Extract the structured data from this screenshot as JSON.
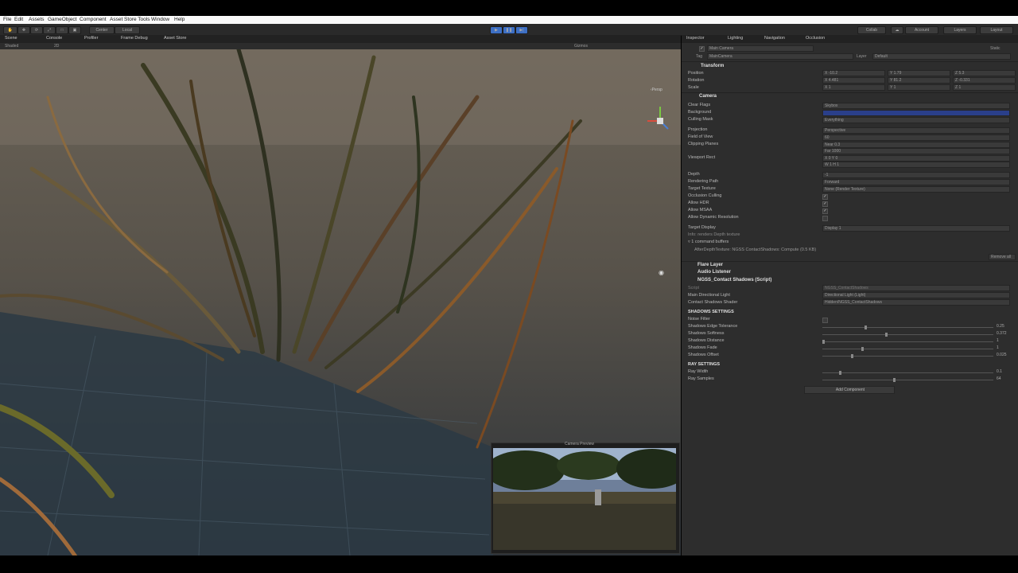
{
  "menu": [
    "File",
    "Edit",
    "Assets",
    "GameObject",
    "Component",
    "Asset Store Tools",
    "Window",
    "Help"
  ],
  "toolbar": {
    "pivot": "Center",
    "space": "Local",
    "collab": "Collab",
    "account": "Account",
    "layers": "Layers",
    "layout": "Layout"
  },
  "scene_tabs": [
    "Scene",
    "Console",
    "Profiler",
    "Frame Debug",
    "Asset Store"
  ],
  "scene_bar": {
    "shading": "Shaded",
    "mode": "2D",
    "gizmos": "Gizmos",
    "persp": "‹Persp"
  },
  "inspector_tabs": [
    "Inspector",
    "Lighting",
    "Navigation",
    "Occlusion"
  ],
  "gameobject": {
    "name": "Main Camera",
    "static": "Static",
    "tag_label": "Tag",
    "tag": "MainCamera",
    "layer_label": "Layer",
    "layer": "Default"
  },
  "transform": {
    "title": "Transform",
    "position_label": "Position",
    "position": [
      "X -10.2",
      "Y 1.79",
      "Z 5.3"
    ],
    "rotation_label": "Rotation",
    "rotation": [
      "X 4.481",
      "Y 81.2",
      "Z -0.331"
    ],
    "scale_label": "Scale",
    "scale": [
      "X 1",
      "Y 1",
      "Z 1"
    ]
  },
  "camera": {
    "title": "Camera",
    "rows": [
      {
        "label": "Clear Flags",
        "value": "Skybox"
      },
      {
        "label": "Background",
        "value": ""
      },
      {
        "label": "Culling Mask",
        "value": "Everything"
      },
      {
        "label": "Projection",
        "value": "Perspective"
      },
      {
        "label": "Field of View",
        "value": "60"
      },
      {
        "label": "Clipping Planes",
        "value": "Near  0.3"
      },
      {
        "label": "",
        "value": "Far   1000"
      },
      {
        "label": "Viewport Rect",
        "value": "X 0      Y 0"
      },
      {
        "label": "",
        "value": "W 1      H 1"
      },
      {
        "label": "Depth",
        "value": "-1"
      },
      {
        "label": "Rendering Path",
        "value": "Forward"
      },
      {
        "label": "Target Texture",
        "value": "None (Render Texture)"
      },
      {
        "label": "Occlusion Culling",
        "value": "✓"
      },
      {
        "label": "Allow HDR",
        "value": "✓"
      },
      {
        "label": "Allow MSAA",
        "value": "✓"
      },
      {
        "label": "Allow Dynamic Resolution",
        "value": ""
      },
      {
        "label": "Target Display",
        "value": "Display 1"
      }
    ],
    "info": "Info: renders Depth texture",
    "buffers": "▿ 1 command buffers",
    "buffer_item": "AfterDepthTexture: NGSS ContactShadows: Compute (0.5 KB)",
    "remove_all": "Remove all"
  },
  "components": [
    "Flare Layer",
    "Audio Listener",
    "NGSS_Contact Shadows (Script)"
  ],
  "ngss": {
    "script_label": "Script",
    "script": "NGSS_ContactShadows",
    "main_light_label": "Main Directional Light",
    "main_light": "Directional Light (Light)",
    "shader_label": "Contact Shadows Shader",
    "shader": "Hidden/NGSS_ContactShadows",
    "shadows_header": "SHADOWS SETTINGS",
    "shadow_rows": [
      {
        "label": "Noise Filter",
        "value": "",
        "kind": "check",
        "level": 0
      },
      {
        "label": "Shadows Edge Tolerance",
        "value": "0.25",
        "kind": "slider",
        "level": 0.25
      },
      {
        "label": "Shadows Softness",
        "value": "0.372",
        "kind": "slider",
        "level": 0.372
      },
      {
        "label": "Shadows Distance",
        "value": "1",
        "kind": "slider",
        "level": 0.0
      },
      {
        "label": "Shadows Fade",
        "value": "1",
        "kind": "slider",
        "level": 0.23
      },
      {
        "label": "Shadows Offset",
        "value": "0.025",
        "kind": "slider",
        "level": 0.17
      }
    ],
    "ray_header": "RAY SETTINGS",
    "ray_rows": [
      {
        "label": "Ray Width",
        "value": "0.1",
        "kind": "slider",
        "level": 0.1
      },
      {
        "label": "Ray Samples",
        "value": "64",
        "kind": "slider",
        "level": 0.42
      }
    ]
  },
  "add_component": "Add Component",
  "camera_preview": "Camera Preview",
  "colors": {
    "accent": "#4a7fd4",
    "background_field": "#2a3f8a",
    "panel": "#2d2d2d"
  }
}
